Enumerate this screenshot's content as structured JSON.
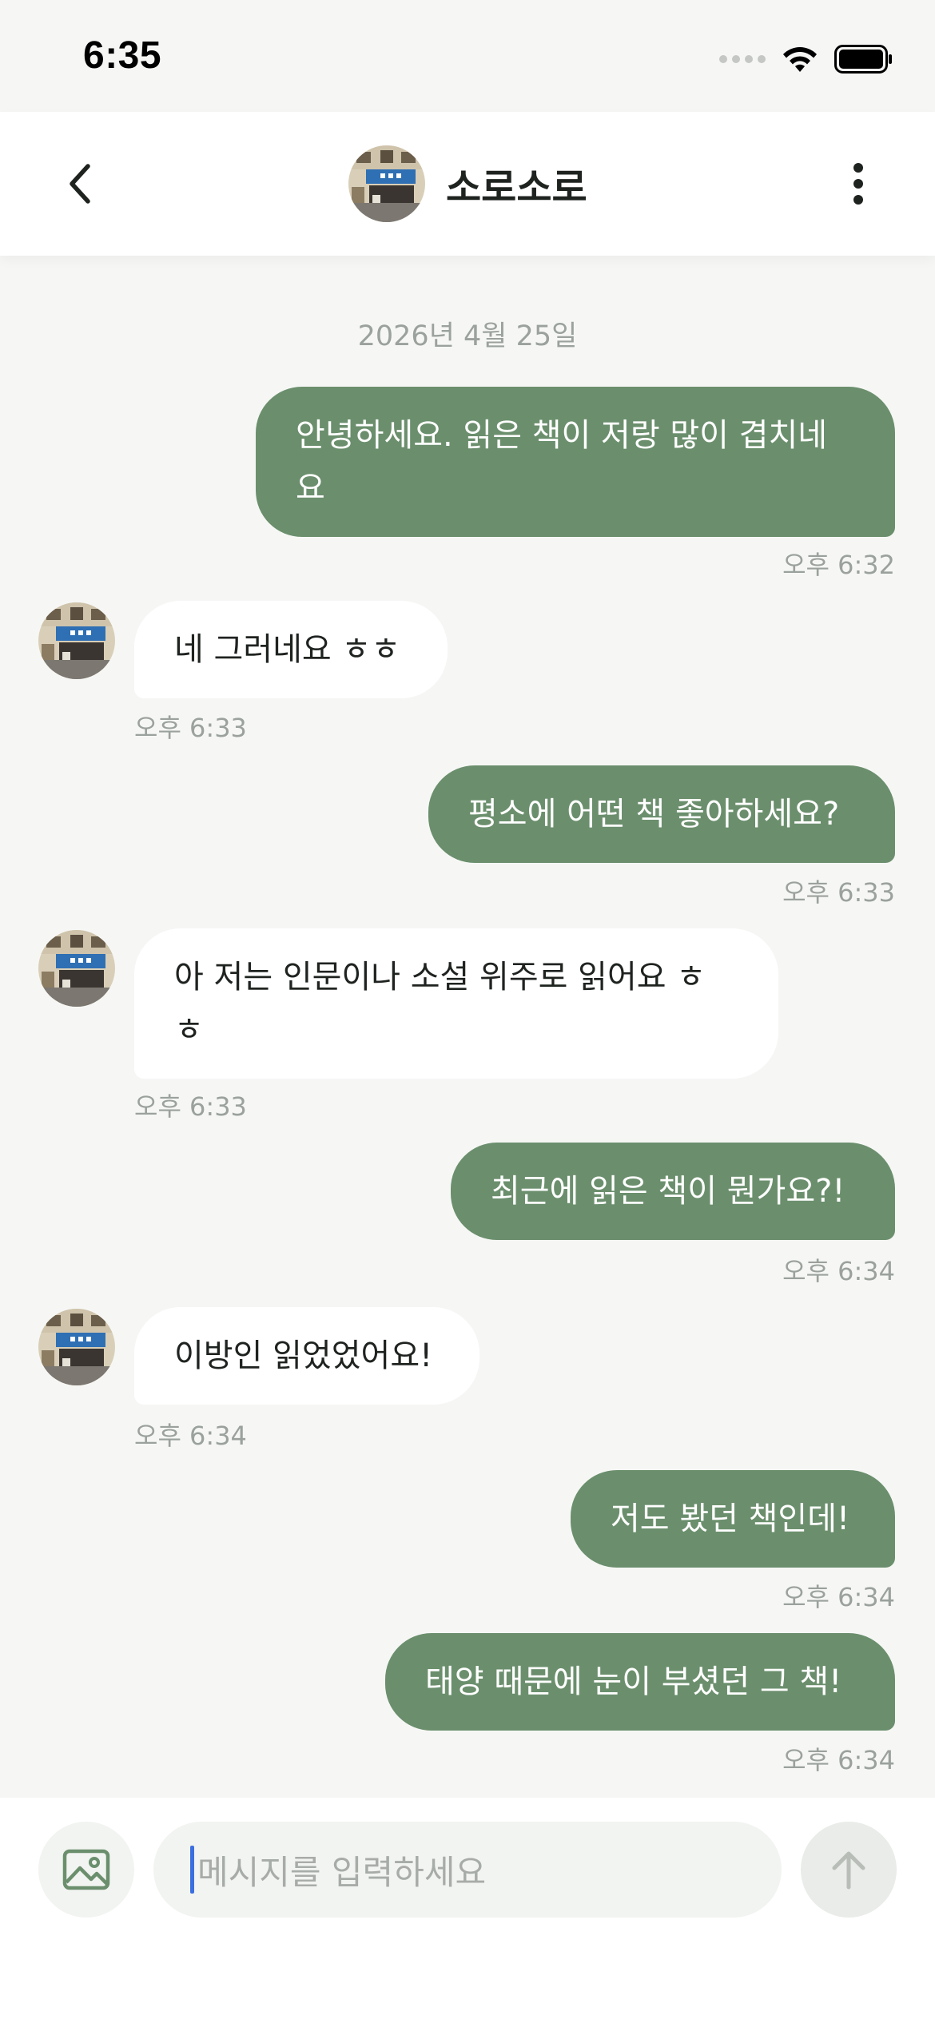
{
  "status_bar": {
    "time": "6:35"
  },
  "header": {
    "title": "소로소로"
  },
  "chat": {
    "date": "2026년 4월 25일",
    "messages": [
      {
        "from": "me",
        "lines": [
          "안녕하세요. 읽은 책이 저랑 많이 겹치네",
          "요"
        ],
        "time": "오후 6:32"
      },
      {
        "from": "them",
        "lines": [
          "네 그러네요 ㅎㅎ"
        ],
        "time": "오후 6:33"
      },
      {
        "from": "me",
        "lines": [
          "평소에 어떤 책 좋아하세요?"
        ],
        "time": "오후 6:33"
      },
      {
        "from": "them",
        "lines": [
          "아 저는 인문이나 소설 위주로 읽어요 ㅎ",
          "ㅎ"
        ],
        "time": "오후 6:33"
      },
      {
        "from": "me",
        "lines": [
          "최근에 읽은 책이 뭔가요?!"
        ],
        "time": "오후 6:34"
      },
      {
        "from": "them",
        "lines": [
          "이방인 읽었었어요!"
        ],
        "time": "오후 6:34"
      },
      {
        "from": "me",
        "lines": [
          "저도 봤던 책인데!"
        ],
        "time": "오후 6:34"
      },
      {
        "from": "me",
        "lines": [
          "태양 때문에 눈이 부셨던 그 책!"
        ],
        "time": "오후 6:34"
      }
    ]
  },
  "input": {
    "placeholder": "메시지를 입력하세요"
  },
  "colors": {
    "accent": "#6b8f6d",
    "background": "#f6f7f5",
    "bubble_them": "#ffffff",
    "muted_text": "#9ba19c"
  },
  "icons": {
    "back": "chevron-left-icon",
    "more": "more-vertical-icon",
    "image": "image-icon",
    "send": "arrow-up-icon"
  }
}
